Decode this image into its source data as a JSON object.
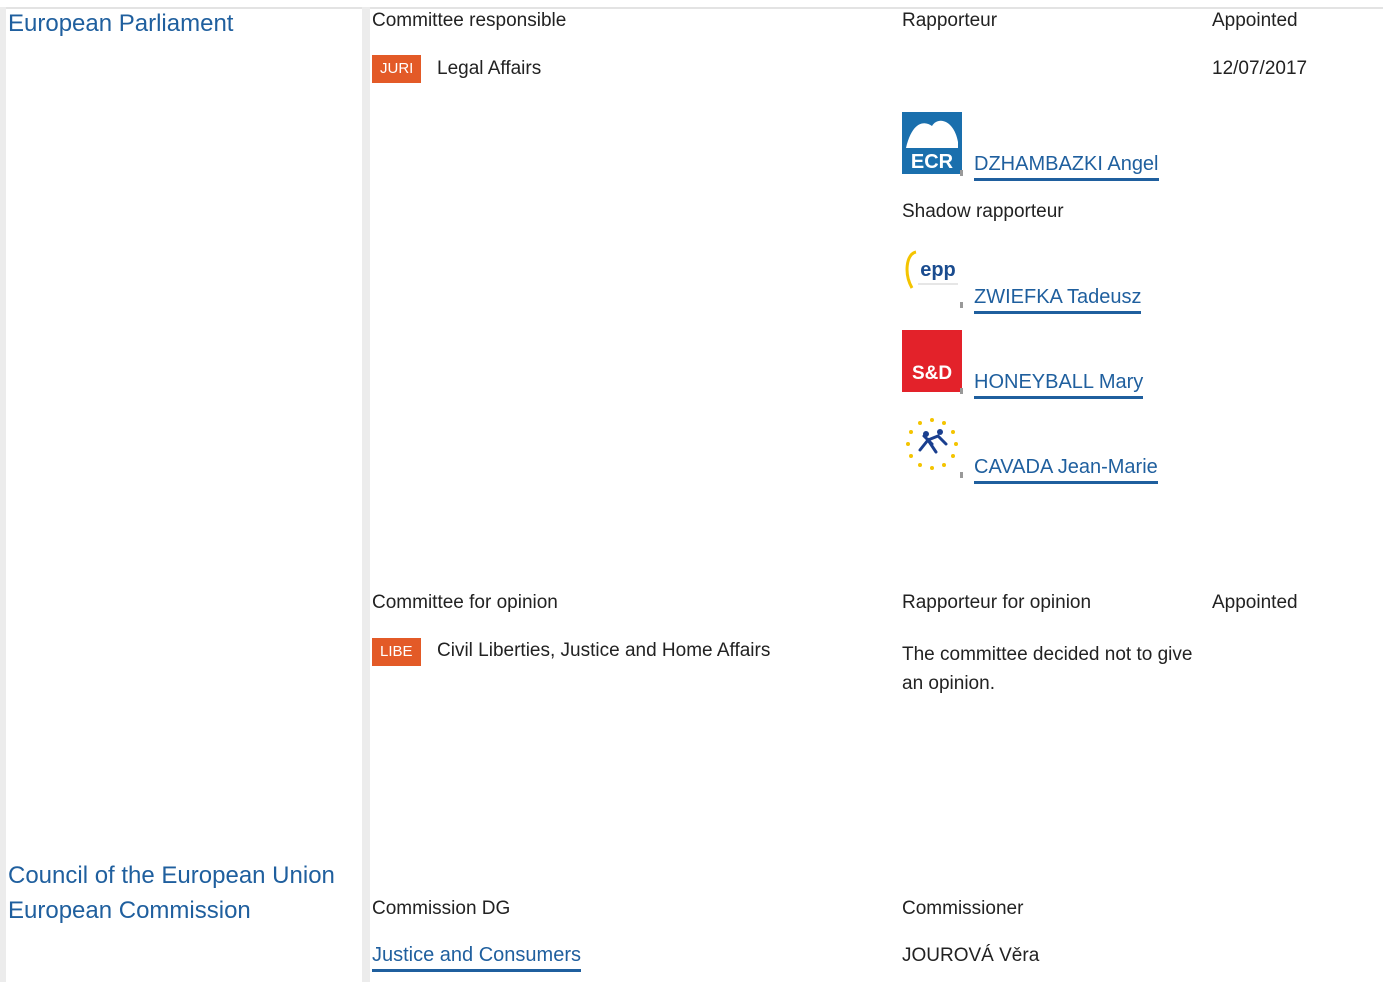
{
  "institutions": {
    "ep": "European Parliament",
    "council": "Council of the European Union",
    "commission": "European Commission"
  },
  "responsible": {
    "header_committee": "Committee responsible",
    "header_rapporteur": "Rapporteur",
    "header_appointed": "Appointed",
    "committee_code": "JURI",
    "committee_name": "Legal Affairs",
    "appointed_date": "12/07/2017",
    "rapporteur": {
      "group_logo": "ECR",
      "name": "DZHAMBAZKI Angel"
    },
    "shadow_label": "Shadow rapporteur",
    "shadows": [
      {
        "group_logo": "epp",
        "name": "ZWIEFKA Tadeusz"
      },
      {
        "group_logo": "S&D",
        "name": "HONEYBALL Mary"
      },
      {
        "group_logo": "renew-stars",
        "name": "CAVADA Jean-Marie"
      }
    ]
  },
  "opinion": {
    "header_committee": "Committee for opinion",
    "header_rapporteur": "Rapporteur for opinion",
    "header_appointed": "Appointed",
    "committee_code": "LIBE",
    "committee_name": "Civil Liberties, Justice and Home Affairs",
    "decision": "The committee decided not to give an opinion."
  },
  "commission": {
    "header_dg": "Commission DG",
    "header_commissioner": "Commissioner",
    "dg": "Justice and Consumers",
    "commissioner": "JOUROVÁ Věra"
  },
  "colors": {
    "link": "#1f5f9e",
    "badge": "#e35a27",
    "ecr": "#1a6fad",
    "sd": "#e3222a"
  }
}
